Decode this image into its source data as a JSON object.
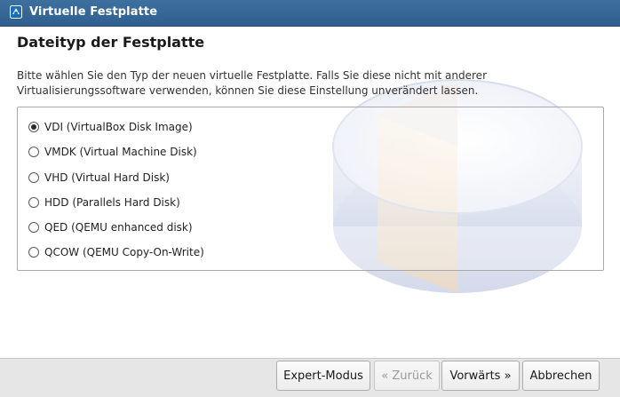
{
  "window": {
    "title": "Virtuelle Festplatte",
    "icon": "virtualbox-app-icon"
  },
  "page": {
    "heading": "Dateityp der Festplatte",
    "description": "Bitte wählen Sie den Typ der neuen virtuelle Festplatte. Falls Sie diese nicht mit anderer Virtualisierungssoftware verwenden, können Sie diese Einstellung unverändert lassen."
  },
  "options": [
    {
      "label": "VDI (VirtualBox Disk Image)",
      "checked": true
    },
    {
      "label": "VMDK (Virtual Machine Disk)",
      "checked": false
    },
    {
      "label": "VHD (Virtual Hard Disk)",
      "checked": false
    },
    {
      "label": "HDD (Parallels Hard Disk)",
      "checked": false
    },
    {
      "label": "QED (QEMU enhanced disk)",
      "checked": false
    },
    {
      "label": "QCOW (QEMU Copy-On-Write)",
      "checked": false
    }
  ],
  "buttons": {
    "expert": "Expert-Modus",
    "back": "« Zurück",
    "next": "Vorwärts »",
    "cancel": "Abbrechen"
  },
  "colors": {
    "titlebar": "#2f5f8f",
    "footer": "#e6e6e6"
  }
}
